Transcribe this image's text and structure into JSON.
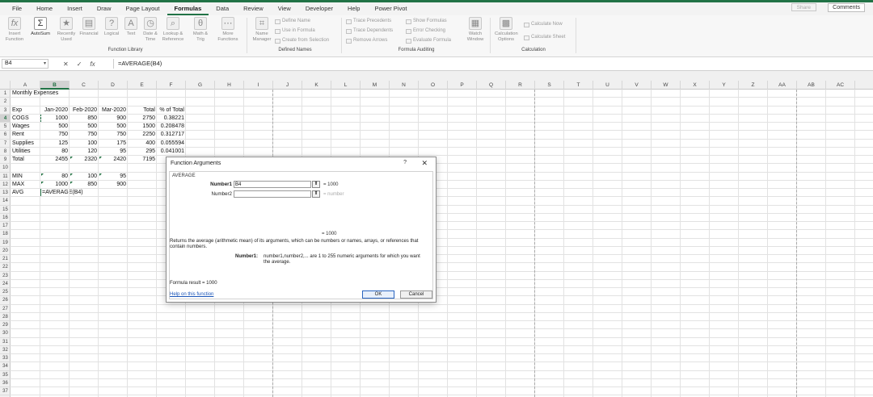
{
  "ribbon_tabs": [
    "File",
    "Home",
    "Insert",
    "Draw",
    "Page Layout",
    "Formulas",
    "Data",
    "Review",
    "View",
    "Developer",
    "Help",
    "Power Pivot"
  ],
  "active_tab": "Formulas",
  "share_label": "Share",
  "comments_label": "Comments",
  "ribbon": {
    "insert_function": "Insert Function",
    "autosum": "AutoSum",
    "recently_used": "Recently Used",
    "financial": "Financial",
    "logical": "Logical",
    "text": "Text",
    "date_time": "Date & Time",
    "lookup_reference": "Lookup & Reference",
    "math_trig": "Math & Trig",
    "more_functions": "More Functions",
    "name_manager": "Name Manager",
    "define_name": "Define Name",
    "use_in_formula": "Use in Formula",
    "create_from_selection": "Create from Selection",
    "trace_precedents": "Trace Precedents",
    "trace_dependents": "Trace Dependents",
    "remove_arrows": "Remove Arrows",
    "show_formulas": "Show Formulas",
    "error_checking": "Error Checking",
    "evaluate_formula": "Evaluate Formula",
    "watch_window": "Watch Window",
    "calculation_options": "Calculation Options",
    "calculate_now": "Calculate Now",
    "calculate_sheet": "Calculate Sheet",
    "group_function_library": "Function Library",
    "group_defined_names": "Defined Names",
    "group_formula_auditing": "Formula Auditing",
    "group_calculation": "Calculation"
  },
  "formula_bar": {
    "name_box": "B4",
    "formula": "=AVERAGE(B4)"
  },
  "columns": [
    "A",
    "B",
    "C",
    "D",
    "E",
    "F",
    "G",
    "H",
    "I",
    "J",
    "K",
    "L",
    "M",
    "N",
    "O",
    "P",
    "Q",
    "R",
    "S",
    "T",
    "U",
    "V",
    "W",
    "X",
    "Y",
    "Z",
    "AA",
    "AB",
    "AC"
  ],
  "rows": [
    "1",
    "2",
    "3",
    "4",
    "5",
    "6",
    "7",
    "8",
    "9",
    "10",
    "11",
    "12",
    "13",
    "14",
    "15",
    "16",
    "17",
    "18",
    "19",
    "20",
    "21",
    "22",
    "23",
    "24",
    "25",
    "26",
    "27",
    "28",
    "29",
    "30",
    "31",
    "32",
    "33",
    "34",
    "35",
    "36",
    "37"
  ],
  "sheet": {
    "title": "Monthly Expenses",
    "headers": [
      "Exp",
      "Jan-2020",
      "Feb-2020",
      "Mar-2020",
      "Total",
      "% of Total"
    ],
    "data": [
      [
        "COGS",
        "1000",
        "850",
        "900",
        "2750",
        "0.38221"
      ],
      [
        "Wages",
        "500",
        "500",
        "500",
        "1500",
        "0.208478"
      ],
      [
        "Rent",
        "750",
        "750",
        "750",
        "2250",
        "0.312717"
      ],
      [
        "Supplies",
        "125",
        "100",
        "175",
        "400",
        "0.055594"
      ],
      [
        "Utilities",
        "80",
        "120",
        "95",
        "295",
        "0.041001"
      ],
      [
        "Total",
        "2455",
        "2320",
        "2420",
        "7195",
        ""
      ]
    ],
    "min_row": [
      "MIN",
      "80",
      "100",
      "95"
    ],
    "max_row": [
      "MAX",
      "1000",
      "850",
      "900"
    ],
    "avg_row": [
      "AVG",
      "=AVERAGE(B4)"
    ]
  },
  "dialog": {
    "title": "Function Arguments",
    "help_glyph": "?",
    "close_glyph": "✕",
    "function_name": "AVERAGE",
    "arg1_label": "Number1",
    "arg1_value": "B4",
    "arg1_result": "= 1000",
    "arg2_label": "Number2",
    "arg2_value": "",
    "arg2_result": "= number",
    "result_line": "= 1000",
    "description": "Returns the average (arithmetic mean) of its arguments, which can be numbers or names, arrays, or references that contain numbers.",
    "arg_help_name": "Number1:",
    "arg_help_text": "number1,number2,... are 1 to 255 numeric arguments for which you want the average.",
    "formula_result": "Formula result =   1000",
    "help_link": "Help on this function",
    "ok": "OK",
    "cancel": "Cancel"
  }
}
